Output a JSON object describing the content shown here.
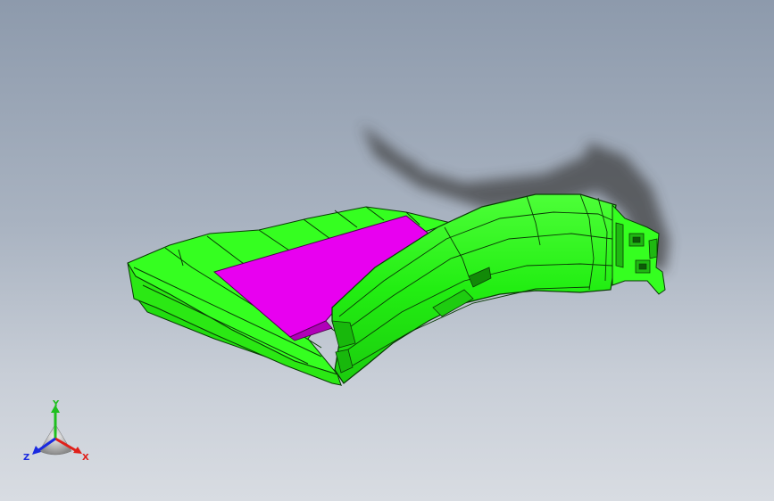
{
  "viewport": {
    "background_top": "#8d9aac",
    "background_bottom": "#d8dce2"
  },
  "model": {
    "body_color": "#33ff1e",
    "edge_color": "#0a3a06",
    "face_color": "#e800f0",
    "shadow_color": "#3c3c3c"
  },
  "triad": {
    "x_label": "X",
    "y_label": "Y",
    "z_label": "Z",
    "x_color": "#e0201a",
    "y_color": "#1fbf1f",
    "z_color": "#1a2ae0"
  }
}
